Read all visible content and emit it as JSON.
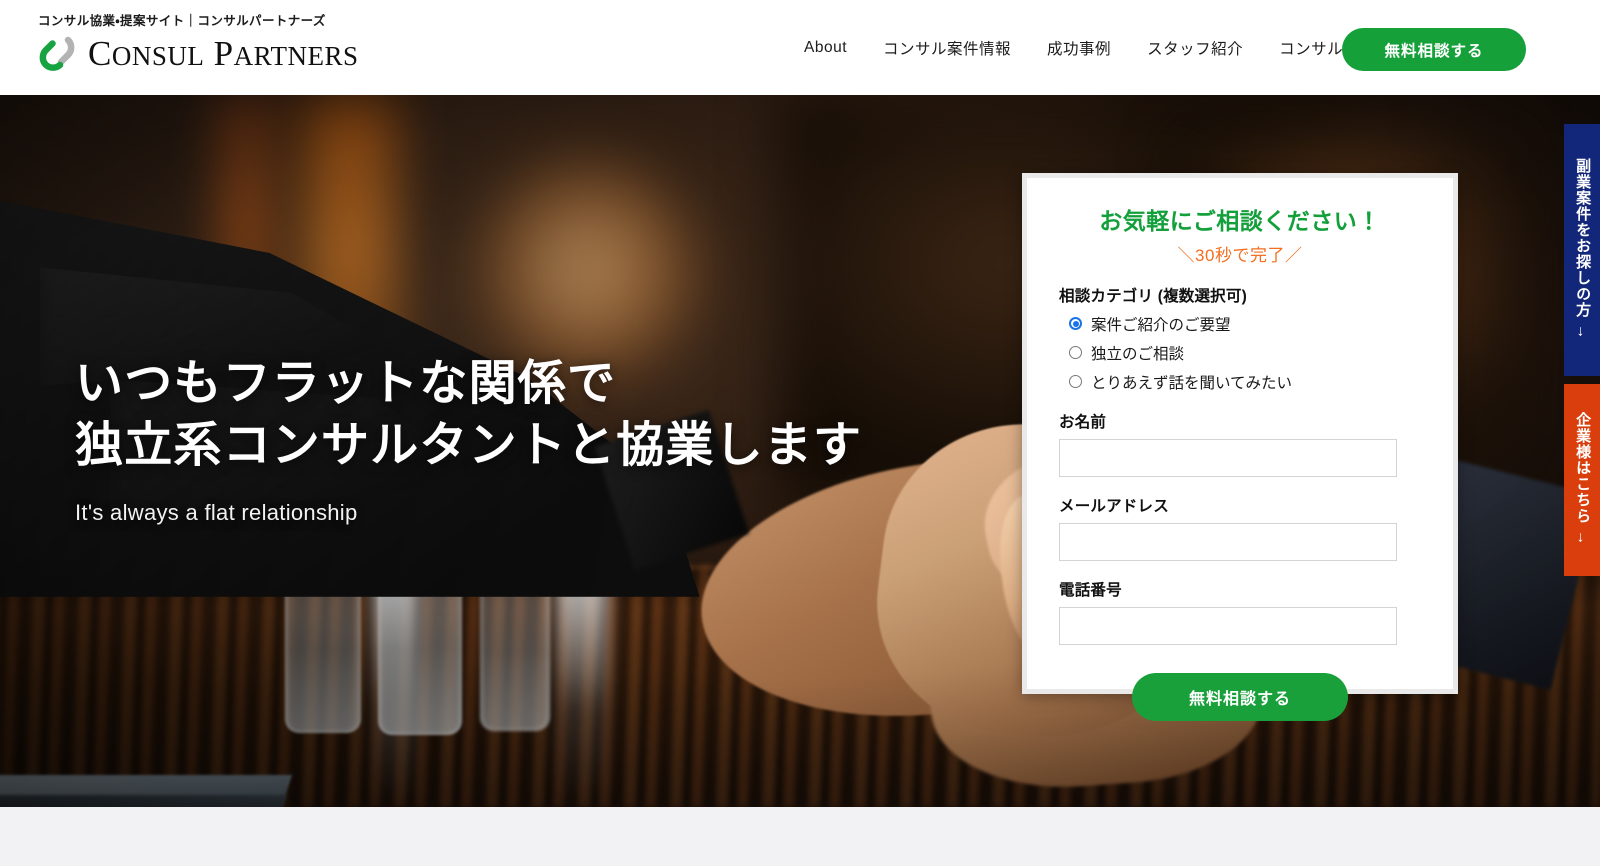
{
  "header": {
    "logo": {
      "tagline": "コンサル協業・提案サイト｜コンサルパートナーズ",
      "wordmark_1": "C",
      "wordmark_2": "ONSUL",
      "wordmark_3": "P",
      "wordmark_4": "ARTNERS",
      "mark_icon": "chain-link-icon",
      "mark_color_primary": "#17a341",
      "mark_color_secondary": "#b3b3b3"
    },
    "nav": [
      {
        "label": "About"
      },
      {
        "label": "コンサル案件情報"
      },
      {
        "label": "成功事例"
      },
      {
        "label": "スタッフ紹介"
      },
      {
        "label": "コンサルメディア"
      }
    ],
    "cta": {
      "label": "無料相談する",
      "color": "#15a03a"
    }
  },
  "hero": {
    "headline_line1": "いつもフラットな関係で",
    "headline_line2": "独立系コンサルタントと協業します",
    "subtitle": "It's always a flat relationship",
    "background_image": "handshake-photo"
  },
  "form": {
    "title": "お気軽にご相談ください！",
    "title_color": "#13a03a",
    "subtitle": "＼30秒で完了／",
    "subtitle_color": "#f36f21",
    "category_label": "相談カテゴリ (複数選択可)",
    "radios": [
      {
        "label": "案件ご紹介のご要望",
        "checked": true
      },
      {
        "label": "独立のご相談",
        "checked": false
      },
      {
        "label": "とりあえず話を聞いてみたい",
        "checked": false
      }
    ],
    "fields": [
      {
        "label": "お名前",
        "value": "",
        "placeholder": ""
      },
      {
        "label": "メールアドレス",
        "value": "",
        "placeholder": ""
      },
      {
        "label": "電話番号",
        "value": "",
        "placeholder": ""
      }
    ],
    "submit": {
      "label": "無料相談する",
      "color": "#1aa03b"
    }
  },
  "side_tabs": [
    {
      "label": "副業案件をお探しの方",
      "arrow": "→",
      "color": "#13277a"
    },
    {
      "label": "企業様はこちら",
      "arrow": "→",
      "color": "#d93e0c"
    }
  ]
}
